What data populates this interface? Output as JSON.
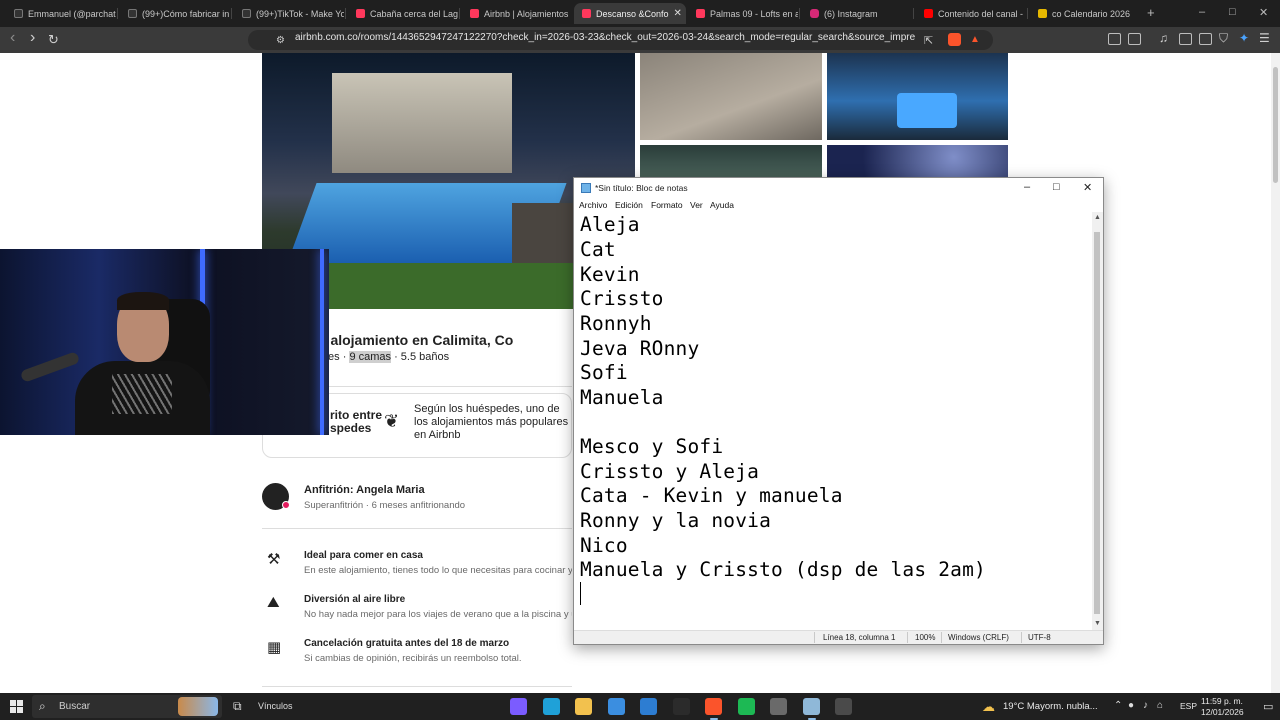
{
  "browser": {
    "tabs": [
      {
        "label": "Emmanuel (@parchate",
        "icon": "tiktok-icon",
        "color": "#333333"
      },
      {
        "label": "(99+)Cómo fabricar in",
        "icon": "tiktok-icon",
        "color": "#333333"
      },
      {
        "label": "(99+)TikTok - Make Yo",
        "icon": "tiktok-icon",
        "color": "#333333"
      },
      {
        "label": "Cabaña cerca del Lago",
        "icon": "airbnb-icon",
        "color": "#ff385c"
      },
      {
        "label": "Airbnb | Alojamientos",
        "icon": "airbnb-icon",
        "color": "#ff385c"
      },
      {
        "label": "Descanso &Confo",
        "icon": "airbnb-icon",
        "color": "#ff385c",
        "active": true
      },
      {
        "label": "Palmas 09 - Lofts en al",
        "icon": "airbnb-icon",
        "color": "#ff385c"
      },
      {
        "label": "(6) Instagram",
        "icon": "instagram-icon",
        "color": "#d62976"
      },
      {
        "label": "Contenido del canal -",
        "icon": "youtube-icon",
        "color": "#ff0000"
      },
      {
        "label": "co Calendario 2026",
        "icon": "calendar-icon",
        "color": "#e6b800"
      }
    ],
    "new_tab": "+",
    "window": {
      "minimize": "–",
      "maximize": "□",
      "close": "✕"
    },
    "nav": {
      "back": "‹",
      "forward": "›",
      "reload": "↻"
    },
    "url": "airbnb.com.co/rooms/1443652947247122270?check_in=2026-03-23&check_out=2026-03-24&search_mode=regular_search&source_impression_id=..."
  },
  "listing": {
    "title": "to entero: alojamiento en Calimita, Co",
    "subtitle_pre": "· 5 habitaciones · ",
    "subtitle_hl": "9 camas",
    "subtitle_post": " · 5.5 baños",
    "favorite_left": "rito entre spedes",
    "favorite_right": "Según los huéspedes, uno de los alojamientos más populares en Airbnb",
    "host_name": "Anfitrión: Angela Maria",
    "host_meta": "Superanfitrión · 6 meses anfitrionando",
    "features": [
      {
        "icon": "utensils-icon",
        "title": "Ideal para comer en casa",
        "desc": "En este alojamiento, tienes todo lo que necesitas para cocinar y"
      },
      {
        "icon": "mountain-icon",
        "title": "Diversión al aire libre",
        "desc": "No hay nada mejor para los viajes de verano que a la piscina y u"
      },
      {
        "icon": "calendar-icon",
        "title": "Cancelación gratuita antes del 18 de marzo",
        "desc": "Si cambias de opinión, recibirás un reembolso total."
      }
    ]
  },
  "notepad": {
    "title": "*Sin título: Bloc de notas",
    "menu": [
      "Archivo",
      "Edición",
      "Formato",
      "Ver",
      "Ayuda"
    ],
    "lines": [
      "Aleja",
      "Cat",
      "Kevin",
      "Crissto",
      "Ronnyh",
      "Jeva ROnny",
      "Sofi",
      "Manuela",
      "",
      "Mesco y Sofi",
      "Crissto y Aleja",
      "Cata - Kevin y manuela",
      "Ronny y la novia",
      "Nico",
      "Manuela y Crissto (dsp de las 2am)"
    ],
    "status": {
      "position": "Línea 18, columna 1",
      "zoom": "100%",
      "line_ending": "Windows (CRLF)",
      "encoding": "UTF-8"
    }
  },
  "taskbar": {
    "search_placeholder": "Buscar",
    "vinculos": "Vínculos",
    "apps": [
      {
        "icon": "copilot-icon",
        "color": "#7b5cff"
      },
      {
        "icon": "edge-icon",
        "color": "#1fa1d8"
      },
      {
        "icon": "file-explorer-icon",
        "color": "#f2c14e"
      },
      {
        "icon": "microsoft-store-icon",
        "color": "#3b8ee0"
      },
      {
        "icon": "mail-icon",
        "color": "#2d7dd2"
      },
      {
        "icon": "obs-icon",
        "color": "#2b2b2b"
      },
      {
        "icon": "brave-icon",
        "color": "#fb542b",
        "active": true
      },
      {
        "icon": "spotify-icon",
        "color": "#1db954"
      },
      {
        "icon": "settings-icon",
        "color": "#6a6a6a"
      },
      {
        "icon": "notepad-icon",
        "color": "#8fb8d8",
        "active": true
      },
      {
        "icon": "calculator-icon",
        "color": "#4a4a4a"
      }
    ],
    "weather": "19°C  Mayorm. nubla...",
    "language": "ESP",
    "time": "11:59 p. m.",
    "date": "12/01/2026"
  }
}
